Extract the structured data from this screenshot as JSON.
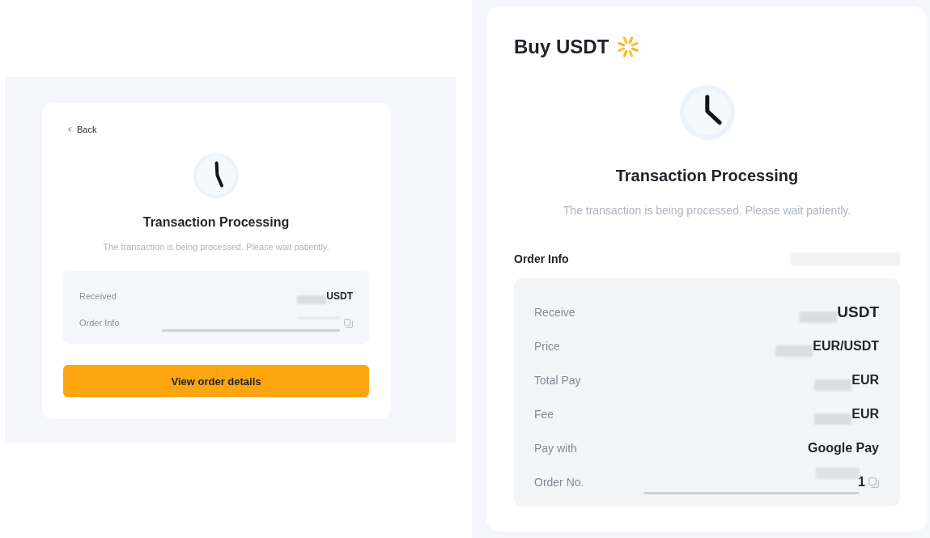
{
  "left_panel": {
    "back_link": {
      "label": "Back"
    },
    "status": {
      "title": "Transaction Processing",
      "message": "The transaction is being processed. Please wait patiently."
    },
    "info": [
      {
        "label": "Received",
        "kind": "amount",
        "value": "USDT",
        "redacted": true
      },
      {
        "label": "Order Info",
        "kind": "id",
        "redacted": true
      }
    ],
    "button": {
      "label": "View order details"
    }
  },
  "right_panel": {
    "title": "Buy USDT",
    "status": {
      "title": "Transaction Processing",
      "message": "The transaction is being processed. Please wait patiently."
    },
    "section": {
      "title": "Order Info",
      "redacted": true
    },
    "rows": [
      {
        "label": "Receive",
        "kind": "amount",
        "value": "USDT",
        "redacted": true
      },
      {
        "label": "Price",
        "kind": "text",
        "value": "EUR/USDT",
        "redacted": true
      },
      {
        "label": "Total Pay",
        "kind": "text",
        "value": "EUR",
        "redacted": true
      },
      {
        "label": "Fee",
        "kind": "text",
        "value": "EUR",
        "redacted": true
      },
      {
        "label": "Pay with",
        "kind": "text",
        "value": "Google Pay",
        "redacted": false
      },
      {
        "label": "Order No.",
        "kind": "id",
        "value": "1",
        "redacted": true
      }
    ]
  }
}
